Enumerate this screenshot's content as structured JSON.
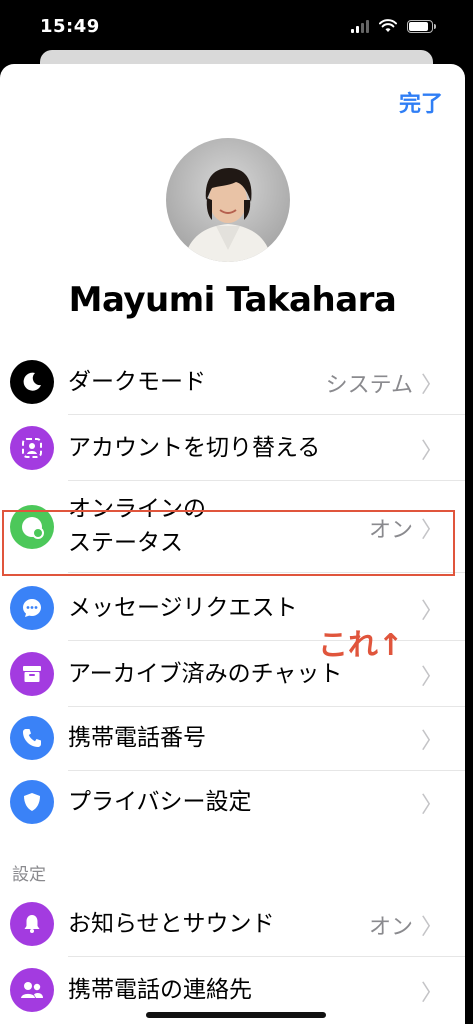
{
  "status": {
    "time": "15:49",
    "battery_level": 0.95
  },
  "header": {
    "done_label": "完了"
  },
  "profile": {
    "name": "Mayumi Takahara"
  },
  "menu": [
    {
      "id": "dark-mode",
      "label": "ダークモード",
      "value": "システム",
      "icon": "moon-icon",
      "color": "#000000"
    },
    {
      "id": "switch-account",
      "label": "アカウントを切り替える",
      "value": "",
      "icon": "switch-account-icon",
      "color": "#a33be0"
    },
    {
      "id": "active-status",
      "label_line1": "オンラインの",
      "label_line2": "ステータス",
      "value": "オン",
      "icon": "active-status-icon",
      "color": "#4cc85a"
    },
    {
      "id": "message-requests",
      "label": "メッセージリクエスト",
      "value": "",
      "icon": "chat-bubble-icon",
      "color": "#3a82f7"
    },
    {
      "id": "archived-chats",
      "label": "アーカイブ済みのチャット",
      "value": "",
      "icon": "archive-icon",
      "color": "#a33be0"
    },
    {
      "id": "phone-number",
      "label": "携帯電話番号",
      "value": "",
      "icon": "phone-icon",
      "color": "#3a82f7"
    },
    {
      "id": "privacy",
      "label": "プライバシー設定",
      "value": "",
      "icon": "shield-icon",
      "color": "#3a82f7"
    }
  ],
  "settings_header": "設定",
  "settings_menu": [
    {
      "id": "notifications",
      "label": "お知らせとサウンド",
      "value": "オン",
      "icon": "bell-icon",
      "color": "#a33be0"
    },
    {
      "id": "contacts",
      "label": "携帯電話の連絡先",
      "value": "",
      "icon": "contacts-icon",
      "color": "#a33be0"
    }
  ],
  "annotation": {
    "text": "これ↑",
    "color": "#e0553c"
  }
}
